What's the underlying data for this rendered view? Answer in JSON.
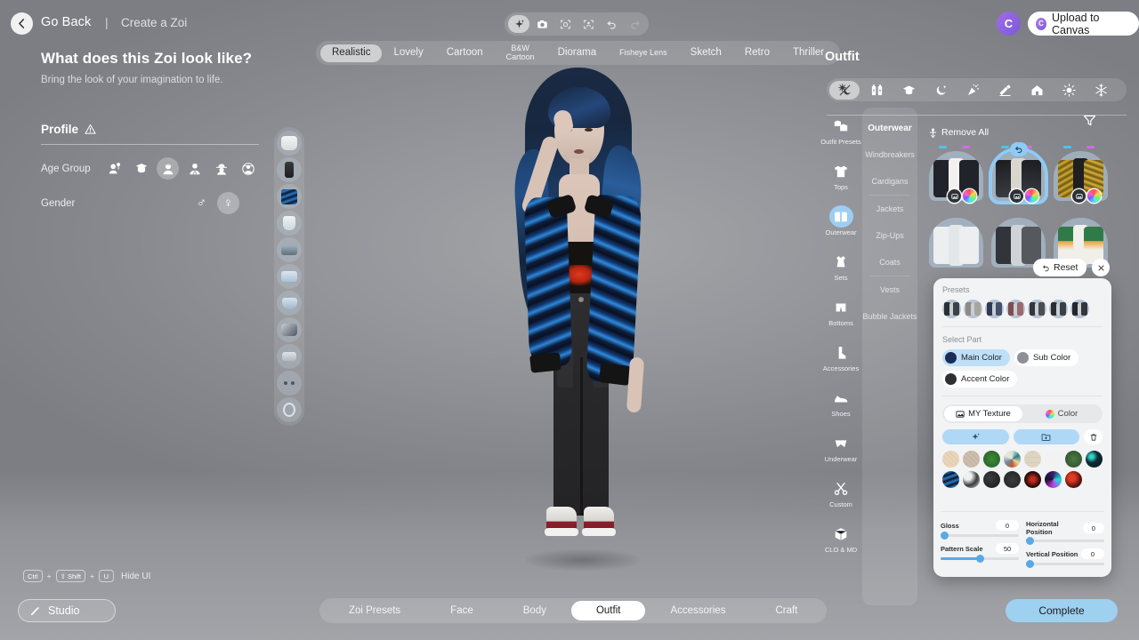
{
  "app": {
    "back_label": "Go Back",
    "separator": "|",
    "breadcrumb": "Create a Zoi",
    "heading": "What does this Zoi look like?",
    "subheading": "Bring the look of your imagination to life."
  },
  "toolbar": {
    "tools": [
      {
        "name": "sparkle-icon",
        "active": true
      },
      {
        "name": "camera-icon",
        "active": false
      },
      {
        "name": "face-focus-icon",
        "active": false
      },
      {
        "name": "body-focus-icon",
        "active": false
      },
      {
        "name": "undo-icon",
        "active": false
      },
      {
        "name": "redo-icon",
        "active": false,
        "disabled": true
      }
    ]
  },
  "account": {
    "avatar_initial": "C",
    "upload_label": "Upload to Canvas"
  },
  "style_tabs": [
    {
      "label": "Realistic",
      "active": true
    },
    {
      "label": "Lovely",
      "active": false
    },
    {
      "label": "Cartoon",
      "active": false
    },
    {
      "label": "B&W\nCartoon",
      "active": false,
      "small": true
    },
    {
      "label": "Diorama",
      "active": false
    },
    {
      "label": "Fisheye Lens",
      "active": false,
      "small": true
    },
    {
      "label": "Sketch",
      "active": false
    },
    {
      "label": "Retro",
      "active": false
    },
    {
      "label": "Thriller",
      "active": false
    }
  ],
  "profile": {
    "title": "Profile",
    "warning_icon": "warning-triangle-icon",
    "age_group_label": "Age Group",
    "age_groups": [
      {
        "name": "infant",
        "active": false
      },
      {
        "name": "child",
        "active": false
      },
      {
        "name": "teen",
        "active": true
      },
      {
        "name": "young-adult",
        "active": false
      },
      {
        "name": "adult",
        "active": false
      },
      {
        "name": "elder",
        "active": false
      }
    ],
    "gender_label": "Gender",
    "genders": [
      {
        "name": "male",
        "glyph": "♂",
        "active": false
      },
      {
        "name": "female",
        "glyph": "♀",
        "active": true
      }
    ]
  },
  "equipped_strip": [
    {
      "name": "top",
      "color": "#e8e9ea"
    },
    {
      "name": "bottom",
      "color": "#2b2b2d"
    },
    {
      "name": "outerwear",
      "color": "#3d5d82"
    },
    {
      "name": "socks",
      "color": "#dfe5ea"
    },
    {
      "name": "shoes",
      "color": "#8a9aa8"
    },
    {
      "name": "bra",
      "color": "#b9cfe2"
    },
    {
      "name": "underwear",
      "color": "#aac4da"
    },
    {
      "name": "accessory",
      "color": "#6c7a88"
    },
    {
      "name": "bag",
      "color": "#c3c9d0"
    },
    {
      "name": "glasses",
      "color": "#6e7682"
    },
    {
      "name": "hat",
      "color": "#d6dade"
    }
  ],
  "right_panel": {
    "title": "Outfit",
    "occasions": [
      {
        "name": "daily",
        "active": true
      },
      {
        "name": "work",
        "active": false
      },
      {
        "name": "school",
        "active": false
      },
      {
        "name": "night",
        "active": false
      },
      {
        "name": "party",
        "active": false
      },
      {
        "name": "sports",
        "active": false
      },
      {
        "name": "home",
        "active": false
      },
      {
        "name": "summer",
        "active": false
      },
      {
        "name": "winter",
        "active": false
      }
    ],
    "categories": [
      {
        "label": "Outfit Presets",
        "icon": "outfit-presets-icon",
        "active": false
      },
      {
        "label": "Tops",
        "icon": "tshirt-icon",
        "active": false
      },
      {
        "label": "Outerwear",
        "icon": "outerwear-icon",
        "active": true
      },
      {
        "label": "Sets",
        "icon": "dress-icon",
        "active": false
      },
      {
        "label": "Bottoms",
        "icon": "shorts-icon",
        "active": false
      },
      {
        "label": "Accessories",
        "icon": "boot-icon",
        "active": false
      },
      {
        "label": "Shoes",
        "icon": "sneaker-icon",
        "active": false
      },
      {
        "label": "Underwear",
        "icon": "underwear-icon",
        "active": false
      },
      {
        "label": "Custom",
        "icon": "scissors-icon",
        "active": false
      },
      {
        "label": "CLO & MD",
        "icon": "cube-icon",
        "active": false
      }
    ],
    "subcategories": [
      {
        "label": "Outerwear",
        "active": true
      },
      {
        "label": "Windbreakers",
        "active": false
      },
      {
        "label": "Cardigans",
        "active": false
      },
      {
        "label": "Jackets",
        "active": false
      },
      {
        "label": "Zip-Ups",
        "active": false
      },
      {
        "label": "Coats",
        "active": false
      },
      {
        "label": "Vests",
        "active": false
      },
      {
        "label": "Bubble Jackets",
        "active": false
      }
    ],
    "remove_all_label": "Remove All",
    "filter_icon": "filter-funnel-icon",
    "items": [
      {
        "name": "white-black-jacket",
        "left": "#1d2026",
        "right": "#1d2026",
        "body": "#f0efed",
        "selected": false,
        "has_ticks": true
      },
      {
        "name": "black-denim-jacket",
        "left": "#26272b",
        "right": "#26272b",
        "body": "#d6d3cd",
        "selected": true,
        "has_ticks": true
      },
      {
        "name": "gold-jacket",
        "left": "#c8a22a",
        "right": "#cfa72c",
        "body": "#1f1f21",
        "selected": false,
        "has_ticks": true
      },
      {
        "name": "white-floral-jacket",
        "left": "#eceef0",
        "right": "#eceef0",
        "body": "#e6e8ea",
        "selected": false,
        "has_ticks": false
      },
      {
        "name": "grey-black-jacket",
        "left": "#3a3c40",
        "right": "#55585c",
        "body": "#cfd3d7",
        "selected": false,
        "has_ticks": false
      },
      {
        "name": "green-varsity-jacket",
        "left": "#2f7a46",
        "right": "#2f7a46",
        "body": "#f1efe9",
        "selected": false,
        "has_ticks": false
      }
    ]
  },
  "color_popover": {
    "reset_label": "Reset",
    "close_icon": "close-icon",
    "presets_label": "Presets",
    "presets": [
      {
        "name": "preset-1",
        "left": "#2b2f36",
        "right": "#3c424a"
      },
      {
        "name": "preset-2",
        "left": "#8f8a84",
        "right": "#a9a49d"
      },
      {
        "name": "preset-3",
        "left": "#2e3a52",
        "right": "#44516b"
      },
      {
        "name": "preset-4",
        "left": "#7a5054",
        "right": "#9a6a6e"
      },
      {
        "name": "preset-5",
        "left": "#33363c",
        "right": "#4a4e55"
      },
      {
        "name": "preset-6",
        "left": "#2a2e34",
        "right": "#3a4049"
      },
      {
        "name": "preset-7",
        "left": "#23262b",
        "right": "#33373d"
      }
    ],
    "select_part_label": "Select Part",
    "parts": [
      {
        "label": "Main Color",
        "swatch": "#1b2c57",
        "active": true
      },
      {
        "label": "Sub Color",
        "swatch": "#8d9196",
        "active": false
      },
      {
        "label": "Accent Color",
        "swatch": "#2e3033",
        "active": false
      }
    ],
    "texture_tabs": [
      {
        "label": "MY Texture",
        "icon": "image-icon",
        "active": true
      },
      {
        "label": "Color",
        "icon": "color-wheel-icon",
        "active": false
      }
    ],
    "texture_actions": [
      {
        "name": "generate-texture-button",
        "icon": "sparkle-icon"
      },
      {
        "name": "import-texture-button",
        "icon": "folder-icon"
      },
      {
        "name": "delete-texture-button",
        "icon": "trash-icon"
      }
    ],
    "swatches": [
      {
        "name": "cream-linen",
        "color": "#ead9bd"
      },
      {
        "name": "beige-canvas",
        "color": "#cfc1b0"
      },
      {
        "name": "forest-green",
        "color": "#2f7532"
      },
      {
        "name": "multicolor-patchwork",
        "color": "#9fb7b9"
      },
      {
        "name": "light-grid",
        "color": "#ded4c2"
      },
      {
        "name": "white-faint",
        "color": "#f2f2f2"
      },
      {
        "name": "dark-green-moss",
        "color": "#3f6b3b"
      },
      {
        "name": "teal-sparkle",
        "color": "#123a42"
      },
      {
        "name": "blue-flame",
        "color": "#123a72"
      },
      {
        "name": "grey-camo",
        "color": "#8d8f90"
      },
      {
        "name": "black-speckle",
        "color": "#24262a"
      },
      {
        "name": "charcoal",
        "color": "#2c2e31"
      },
      {
        "name": "red-on-black",
        "color": "#2a0d0d"
      },
      {
        "name": "neon-graffiti",
        "color": "#2a1646"
      },
      {
        "name": "red-splatter",
        "color": "#5e1512"
      }
    ],
    "sliders": [
      {
        "label": "Gloss",
        "value": "0",
        "fill": 0
      },
      {
        "label": "Pattern Scale",
        "value": "50",
        "fill": 50
      },
      {
        "label": "Horizontal Position",
        "value": "0",
        "fill": 0
      },
      {
        "label": "Vertical Position",
        "value": "0",
        "fill": 0
      }
    ]
  },
  "bottom": {
    "tabs": [
      {
        "label": "Zoi Presets",
        "active": false
      },
      {
        "label": "Face",
        "active": false
      },
      {
        "label": "Body",
        "active": false
      },
      {
        "label": "Outfit",
        "active": true
      },
      {
        "label": "Accessories",
        "active": false
      },
      {
        "label": "Craft",
        "active": false
      }
    ],
    "shortcut": {
      "key1": "Ctrl",
      "plus1": "+",
      "key2": "⇧ Shift",
      "plus2": "+",
      "key3": "U",
      "label": "Hide UI"
    },
    "studio_label": "Studio",
    "complete_label": "Complete"
  },
  "colors": {
    "accent_blue": "#9ecdf2",
    "panel_bg": "#f2f3f4",
    "viewport_bg": "#93959a"
  }
}
